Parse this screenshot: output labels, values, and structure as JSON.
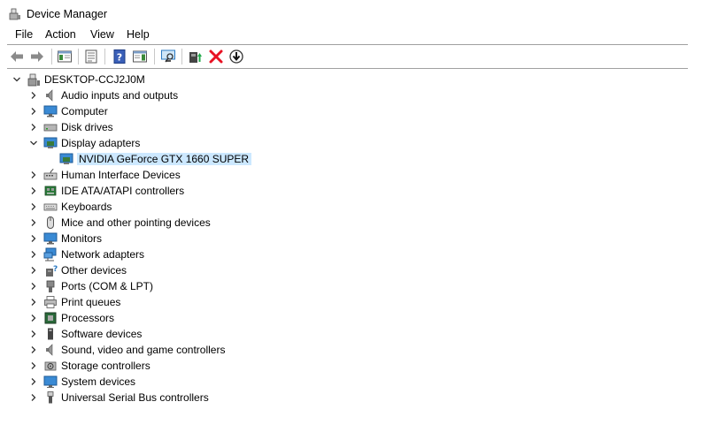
{
  "window": {
    "title": "Device Manager"
  },
  "menu": {
    "file": "File",
    "action": "Action",
    "view": "View",
    "help": "Help"
  },
  "toolbar": {
    "icons": [
      "back-icon",
      "forward-icon",
      "show-hide-tree-icon",
      "properties-icon",
      "help-icon",
      "action-pane-icon",
      "scan-hardware-icon",
      "update-driver-icon",
      "uninstall-icon",
      "disable-device-icon"
    ]
  },
  "tree": {
    "root": "DESKTOP-CCJ2J0M",
    "items": [
      {
        "label": "Audio inputs and outputs",
        "icon": "speaker-icon"
      },
      {
        "label": "Computer",
        "icon": "computer-icon"
      },
      {
        "label": "Disk drives",
        "icon": "disk-drive-icon"
      },
      {
        "label": "Display adapters",
        "icon": "display-adapter-icon",
        "expanded": true
      },
      {
        "label": "NVIDIA GeForce GTX 1660 SUPER",
        "icon": "display-adapter-icon",
        "child": true,
        "selected": true
      },
      {
        "label": "Human Interface Devices",
        "icon": "hid-icon"
      },
      {
        "label": "IDE ATA/ATAPI controllers",
        "icon": "ide-controller-icon"
      },
      {
        "label": "Keyboards",
        "icon": "keyboard-icon"
      },
      {
        "label": "Mice and other pointing devices",
        "icon": "mouse-icon"
      },
      {
        "label": "Monitors",
        "icon": "monitor-icon"
      },
      {
        "label": "Network adapters",
        "icon": "network-adapter-icon"
      },
      {
        "label": "Other devices",
        "icon": "other-devices-icon"
      },
      {
        "label": "Ports (COM & LPT)",
        "icon": "port-icon"
      },
      {
        "label": "Print queues",
        "icon": "printer-icon"
      },
      {
        "label": "Processors",
        "icon": "processor-icon"
      },
      {
        "label": "Software devices",
        "icon": "software-device-icon"
      },
      {
        "label": "Sound, video and game controllers",
        "icon": "sound-controller-icon"
      },
      {
        "label": "Storage controllers",
        "icon": "storage-controller-icon"
      },
      {
        "label": "System devices",
        "icon": "system-devices-icon"
      },
      {
        "label": "Universal Serial Bus controllers",
        "icon": "usb-icon"
      }
    ]
  },
  "colors": {
    "selection": "#cce8ff",
    "accent": "#2b79c2",
    "delete": "#e81123"
  }
}
